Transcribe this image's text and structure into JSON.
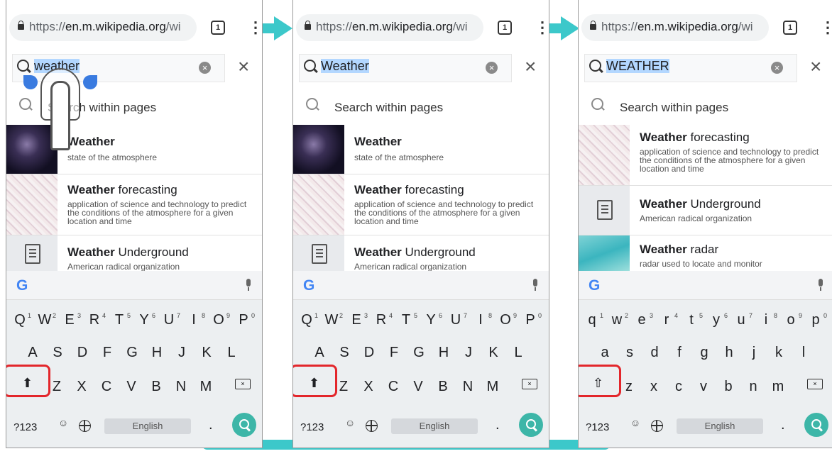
{
  "browser": {
    "url_prefix": "https://",
    "url_host": "en.m.wikipedia.org",
    "url_suffix": "/wi",
    "tab_count": "1"
  },
  "panels": [
    {
      "query_highlight": "weather"
    },
    {
      "query_highlight": "Weather"
    },
    {
      "query_highlight": "WEATHER"
    }
  ],
  "search_within": "Search within pages",
  "results": {
    "weather": {
      "bold": "Weather",
      "rest": "",
      "desc": "state of the atmosphere"
    },
    "forecasting": {
      "bold": "Weather",
      "rest": " forecasting",
      "desc": "application of science and technology to predict the conditions of the atmosphere for a given location and time"
    },
    "underground": {
      "bold": "Weather",
      "rest": " Underground",
      "desc": "American radical organization"
    },
    "radar": {
      "bold": "Weather",
      "rest": " radar",
      "desc": "radar used to locate and monitor"
    }
  },
  "keyboard": {
    "upper": {
      "row1": [
        "Q",
        "W",
        "E",
        "R",
        "T",
        "Y",
        "U",
        "I",
        "O",
        "P"
      ],
      "row2": [
        "A",
        "S",
        "D",
        "F",
        "G",
        "H",
        "J",
        "K",
        "L"
      ],
      "row3": [
        "Z",
        "X",
        "C",
        "V",
        "B",
        "N",
        "M"
      ]
    },
    "lower": {
      "row1": [
        "q",
        "w",
        "e",
        "r",
        "t",
        "y",
        "u",
        "i",
        "o",
        "p"
      ],
      "row2": [
        "a",
        "s",
        "d",
        "f",
        "g",
        "h",
        "j",
        "k",
        "l"
      ],
      "row3": [
        "z",
        "x",
        "c",
        "v",
        "b",
        "n",
        "m"
      ]
    },
    "numbers": [
      "1",
      "2",
      "3",
      "4",
      "5",
      "6",
      "7",
      "8",
      "9",
      "0"
    ],
    "symbols_label": "?123",
    "space_label": "English",
    "period": ".",
    "google_logo": "G"
  },
  "colors": {
    "accent": "#3cc8ca",
    "highlight_box": "#e3262b",
    "go_button": "#3db6a8"
  },
  "icons": [
    "lock-icon",
    "tabs-icon",
    "more-vert-icon",
    "search-icon",
    "clear-icon",
    "close-icon",
    "search-within-icon",
    "document-icon",
    "mic-icon",
    "shift-icon",
    "backspace-icon",
    "emoji-icon",
    "globe-icon",
    "go-icon",
    "finger-tap-icon"
  ]
}
